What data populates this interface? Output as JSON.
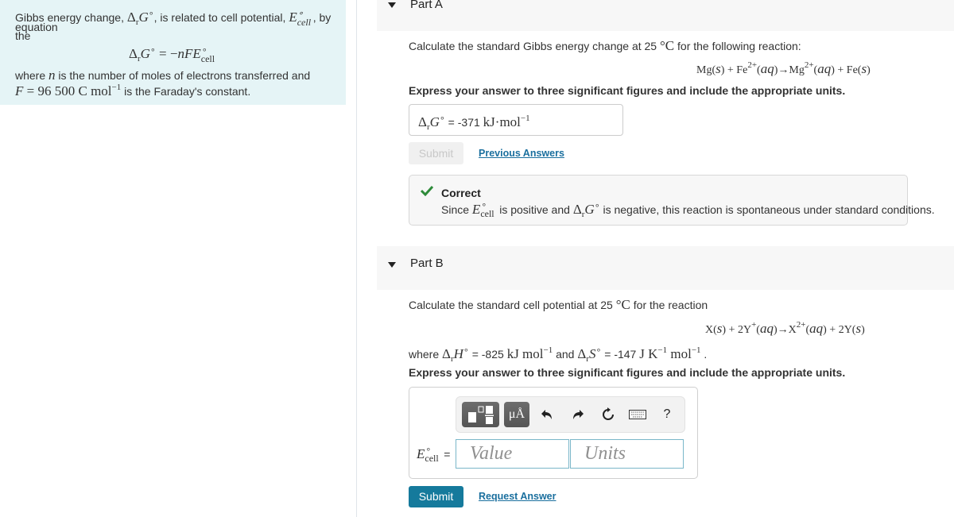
{
  "intro_panel": {
    "line1_a": "Gibbs energy change, ",
    "line1_b": ", is related to cell potential, ",
    "line1_c": ", by the",
    "line2": "equation",
    "equation": "ΔrG° = −nFE°cell",
    "where_a": "where ",
    "where_n": "n",
    "where_b": " is the number of moles of electrons transferred and",
    "faraday_eq": "F = 96 500 C mol",
    "faraday_exp": "−1",
    "faraday_tail": " is the Faraday's constant."
  },
  "part_a": {
    "title": "Part A",
    "question": "Calculate the standard Gibbs energy change at 25",
    "question_tail": " for the following reaction:",
    "temperature_unit": "°C",
    "reaction": {
      "reactant1": "Mg(s)",
      "reactant2": "Fe",
      "reactant2_charge": "2+",
      "reactant2_state": "(aq)",
      "product1": "Mg",
      "product1_charge": "2+",
      "product1_state": "(aq)",
      "product2": "Fe(s)"
    },
    "instruction": "Express your answer to three significant figures and include the appropriate units.",
    "answer_label": "ΔrG° =",
    "answer_value": "-371",
    "answer_unit": "kJ·mol",
    "answer_unit_exp": "−1",
    "submit_label": "Submit",
    "previous_answers_label": "Previous Answers",
    "feedback": {
      "status": "Correct",
      "text_a": "Since ",
      "text_b": " is positive and ",
      "text_c": " is negative, this reaction is spontaneous under standard conditions.",
      "status_color": "#2e8b3a"
    }
  },
  "part_b": {
    "title": "Part B",
    "question": "Calculate the standard cell potential at 25",
    "question_tail": " for the reaction",
    "temperature_unit": "°C",
    "reaction": {
      "reactant1": "X(s)",
      "reactant2": "2Y",
      "reactant2_charge": "+",
      "reactant2_state": "(aq)",
      "product1": "X",
      "product1_charge": "2+",
      "product1_state": "(aq)",
      "product2": "2Y(s)"
    },
    "given_where": "where ",
    "given_dh_label": "ΔrH°",
    "given_dh_value": " = -825 ",
    "given_dh_unit": "kJ mol",
    "given_and": " and ",
    "given_ds_label": "ΔrS°",
    "given_ds_value": " = -147 ",
    "given_ds_unit": "J K",
    "given_ds_unit2": " mol",
    "exp": "−1",
    "instruction": "Express your answer to three significant figures and include the appropriate units.",
    "toolbar": {
      "templates_icon": "templates-icon",
      "units_icon_label": "μÅ",
      "undo_icon": "undo-icon",
      "redo_icon": "redo-icon",
      "reset_icon": "reset-icon",
      "keyboard_icon": "keyboard-icon",
      "help_label": "?"
    },
    "answer_label": "E°cell =",
    "value_placeholder": "Value",
    "units_placeholder": "Units",
    "submit_label": "Submit",
    "request_answer_label": "Request Answer"
  }
}
